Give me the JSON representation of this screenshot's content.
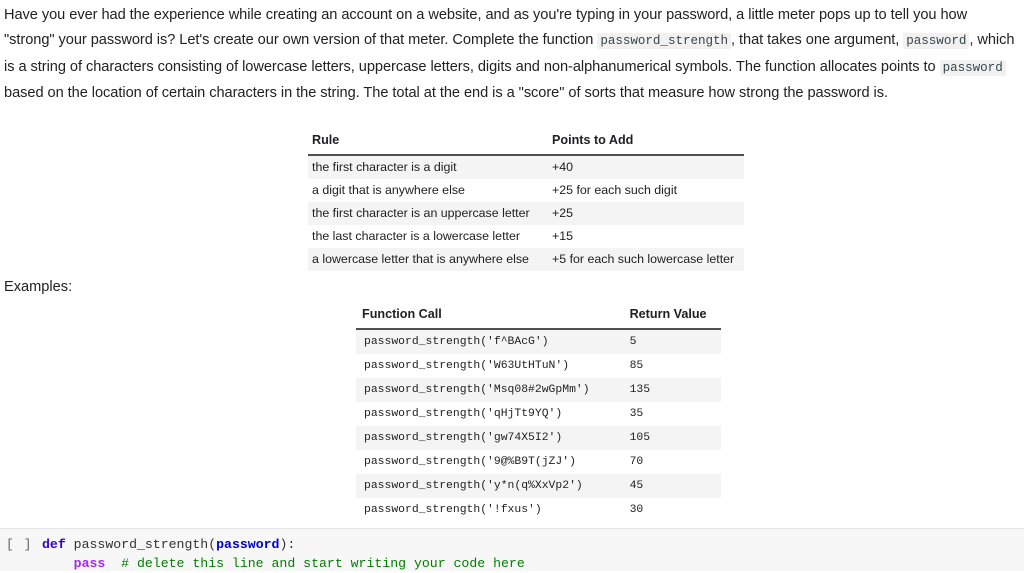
{
  "intro": {
    "seg1": "Have you ever had the experience while creating an account on a website, and as you're typing in your password, a little meter pops up to tell you how \"strong\" your password is? Let's create our own version of that meter. Complete the function ",
    "code1": "password_strength",
    "seg2": ", that takes one argument, ",
    "code2": "password",
    "seg3": ", which is a string of characters consisting of lowercase letters, uppercase letters, digits and non-alphanumerical symbols. The function allocates points to ",
    "code3": "password",
    "seg4": " based on the location of certain characters in the string. The total at the end is a \"score\" of sorts that measure how strong the password is."
  },
  "rules_table": {
    "headers": [
      "Rule",
      "Points to Add"
    ],
    "rows": [
      [
        "the first character is a digit",
        "+40"
      ],
      [
        "a digit that is anywhere else",
        "+25 for each such digit"
      ],
      [
        "the first character is an uppercase letter",
        "+25"
      ],
      [
        "the last character is a lowercase letter",
        "+15"
      ],
      [
        "a lowercase letter that is anywhere else",
        "+5 for each such lowercase letter"
      ]
    ]
  },
  "examples_label": "Examples:",
  "examples_table": {
    "headers": [
      "Function Call",
      "Return Value"
    ],
    "rows": [
      [
        "password_strength('f^BAcG')",
        "5"
      ],
      [
        "password_strength('W63UtHTuN')",
        "85"
      ],
      [
        "password_strength('Msq08#2wGpMm')",
        "135"
      ],
      [
        "password_strength('qHjTt9YQ')",
        "35"
      ],
      [
        "password_strength('gw74X5I2')",
        "105"
      ],
      [
        "password_strength('9@%B9T(jZJ')",
        "70"
      ],
      [
        "password_strength('y*n(q%XxVp2')",
        "45"
      ],
      [
        "password_strength('!fxus')",
        "30"
      ]
    ]
  },
  "code_cell": {
    "prompt": "[ ]",
    "line1": {
      "keyword": "def",
      "space": " ",
      "fn_name": "password_strength",
      "open_paren": "(",
      "param": "password",
      "close_paren_colon": "):"
    },
    "line2": {
      "indent": "    ",
      "pass_kw": "pass",
      "gap": "  ",
      "comment": "# delete this line and start writing your code here"
    }
  },
  "colors": {
    "keyword": "#3300cc",
    "param": "#0000cc",
    "pass": "#aa22ff",
    "comment": "#008000",
    "table_stripe": "#f4f4f4",
    "header_rule": "#4f4f4f",
    "inline_code_bg": "#f1f1f1",
    "cell_bg": "#f7f7f7"
  }
}
